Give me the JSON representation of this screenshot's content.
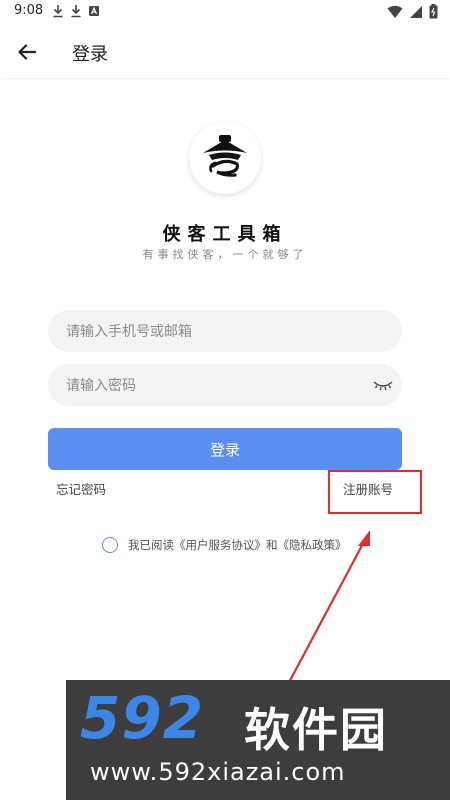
{
  "status_bar": {
    "time": "9:08"
  },
  "app_bar": {
    "title": "登录"
  },
  "brand": {
    "title": "侠客工具箱",
    "slogan": "有事找侠客，一个就够了"
  },
  "form": {
    "account_placeholder": "请输入手机号或邮箱",
    "password_placeholder": "请输入密码",
    "login_label": "登录",
    "forgot_label": "忘记密码",
    "register_label": "注册账号"
  },
  "agreement": {
    "text": "我已阅读《用户服务协议》和《隐私政策》"
  },
  "watermark": {
    "num": "592",
    "cn": "软件园",
    "url": "www.592xiazai.com"
  },
  "colors": {
    "primary": "#5b8ef0",
    "annotation": "#e52b2b",
    "watermark_bg": "#3d3d3d"
  }
}
